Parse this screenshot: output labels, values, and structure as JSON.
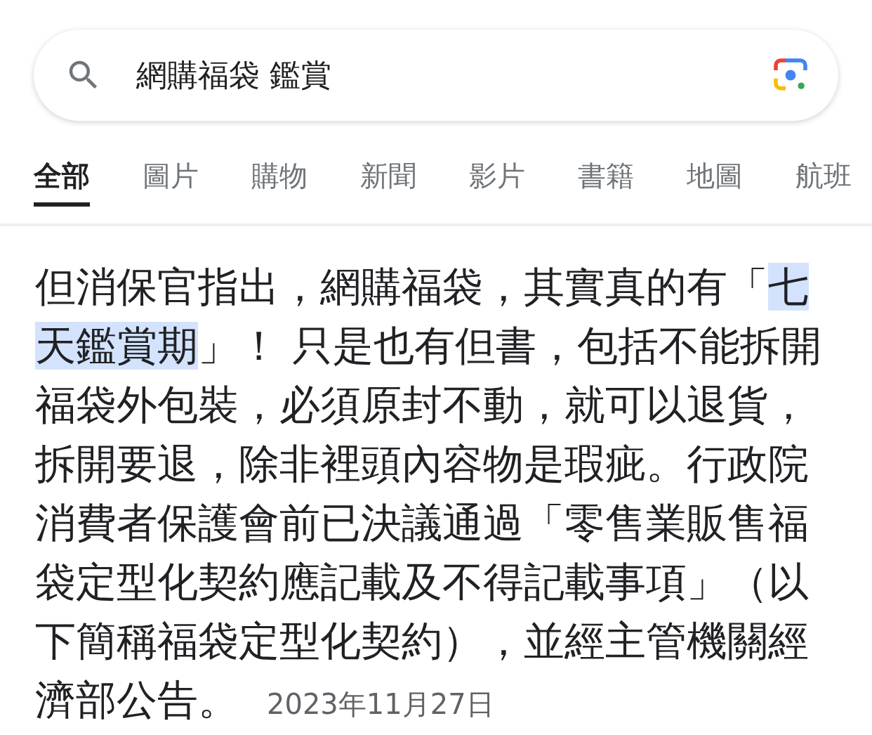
{
  "search": {
    "value": "網購福袋 鑑賞"
  },
  "tabs": [
    {
      "label": "全部",
      "selected": true
    },
    {
      "label": "圖片",
      "selected": false
    },
    {
      "label": "購物",
      "selected": false
    },
    {
      "label": "新聞",
      "selected": false
    },
    {
      "label": "影片",
      "selected": false
    },
    {
      "label": "書籍",
      "selected": false
    },
    {
      "label": "地圖",
      "selected": false
    },
    {
      "label": "航班",
      "selected": false
    }
  ],
  "snippet": {
    "segments": [
      {
        "text": "但消保官指出，網購福袋，其實真的有「",
        "highlighted": false
      },
      {
        "text": "七天鑑賞期",
        "highlighted": true
      },
      {
        "text": "」！ 只是也有但書，包括不能拆開福袋外包裝，必須原封不動，就可以退貨，拆開要退，除非裡頭內容物是瑕疵。行政院消費者保護會前已決議通過「零售業販售福袋定型化契約應記載及不得記載事項」（以下簡稱福袋定型化契約），並經主管機關經濟部公告。",
        "highlighted": false
      }
    ],
    "date": "2023年11月27日"
  }
}
